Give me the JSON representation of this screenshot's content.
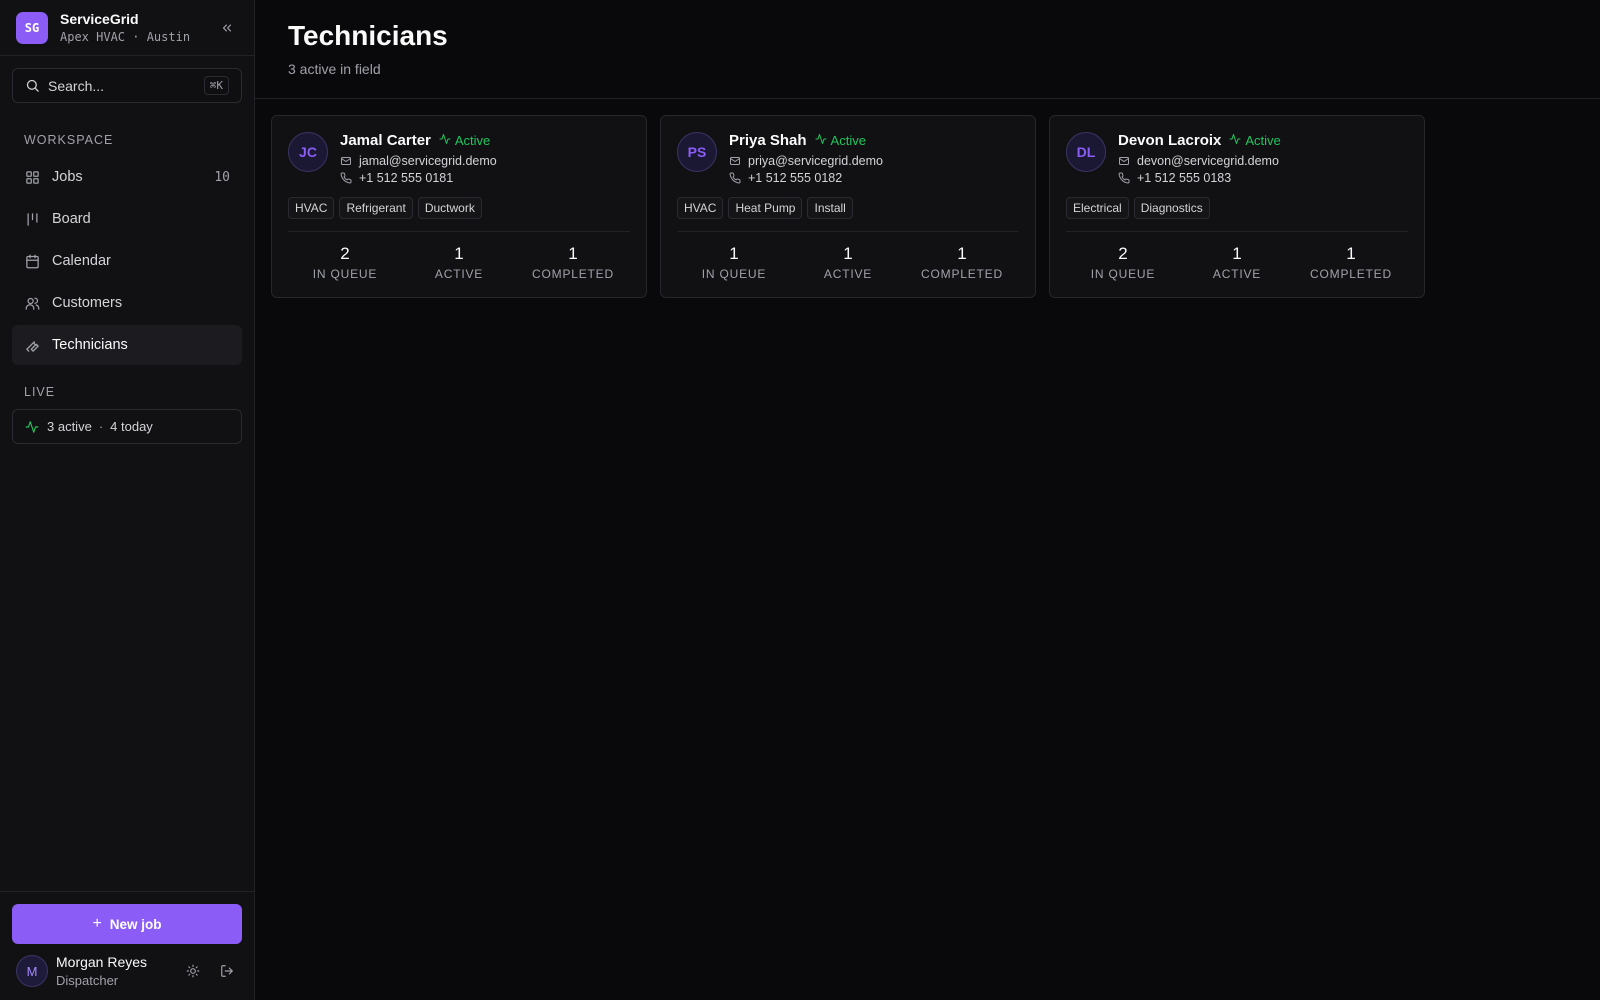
{
  "brand": {
    "logo": "SG",
    "name": "ServiceGrid",
    "subtitle": "Apex HVAC · Austin"
  },
  "search": {
    "placeholder": "Search...",
    "shortcut": "⌘K"
  },
  "sections": {
    "workspace": "WORKSPACE",
    "live": "LIVE"
  },
  "nav": [
    {
      "label": "Jobs",
      "icon": "grid-icon",
      "count": "10"
    },
    {
      "label": "Board",
      "icon": "board-icon",
      "count": ""
    },
    {
      "label": "Calendar",
      "icon": "calendar-icon",
      "count": ""
    },
    {
      "label": "Customers",
      "icon": "users-icon",
      "count": ""
    },
    {
      "label": "Technicians",
      "icon": "wrench-icon",
      "count": "",
      "active": true
    }
  ],
  "live": {
    "active": "3 active",
    "separator": "·",
    "today": "4 today"
  },
  "actions": {
    "new_job": "New job"
  },
  "user": {
    "initial": "M",
    "name": "Morgan Reyes",
    "role": "Dispatcher"
  },
  "page": {
    "title": "Technicians",
    "subtitle": "3 active in field"
  },
  "colors": {
    "accent": "#8b5cf6",
    "status_active": "#22c55e",
    "background": "#09090b"
  },
  "technicians": [
    {
      "initials": "JC",
      "name": "Jamal Carter",
      "status": "Active",
      "email": "jamal@servicegrid.demo",
      "phone": "+1 512 555 0181",
      "tags": [
        "HVAC",
        "Refrigerant",
        "Ductwork"
      ],
      "stats": [
        {
          "value": "2",
          "label": "IN QUEUE"
        },
        {
          "value": "1",
          "label": "ACTIVE"
        },
        {
          "value": "1",
          "label": "COMPLETED"
        }
      ]
    },
    {
      "initials": "PS",
      "name": "Priya Shah",
      "status": "Active",
      "email": "priya@servicegrid.demo",
      "phone": "+1 512 555 0182",
      "tags": [
        "HVAC",
        "Heat Pump",
        "Install"
      ],
      "stats": [
        {
          "value": "1",
          "label": "IN QUEUE"
        },
        {
          "value": "1",
          "label": "ACTIVE"
        },
        {
          "value": "1",
          "label": "COMPLETED"
        }
      ]
    },
    {
      "initials": "DL",
      "name": "Devon Lacroix",
      "status": "Active",
      "email": "devon@servicegrid.demo",
      "phone": "+1 512 555 0183",
      "tags": [
        "Electrical",
        "Diagnostics"
      ],
      "stats": [
        {
          "value": "2",
          "label": "IN QUEUE"
        },
        {
          "value": "1",
          "label": "ACTIVE"
        },
        {
          "value": "1",
          "label": "COMPLETED"
        }
      ]
    }
  ]
}
